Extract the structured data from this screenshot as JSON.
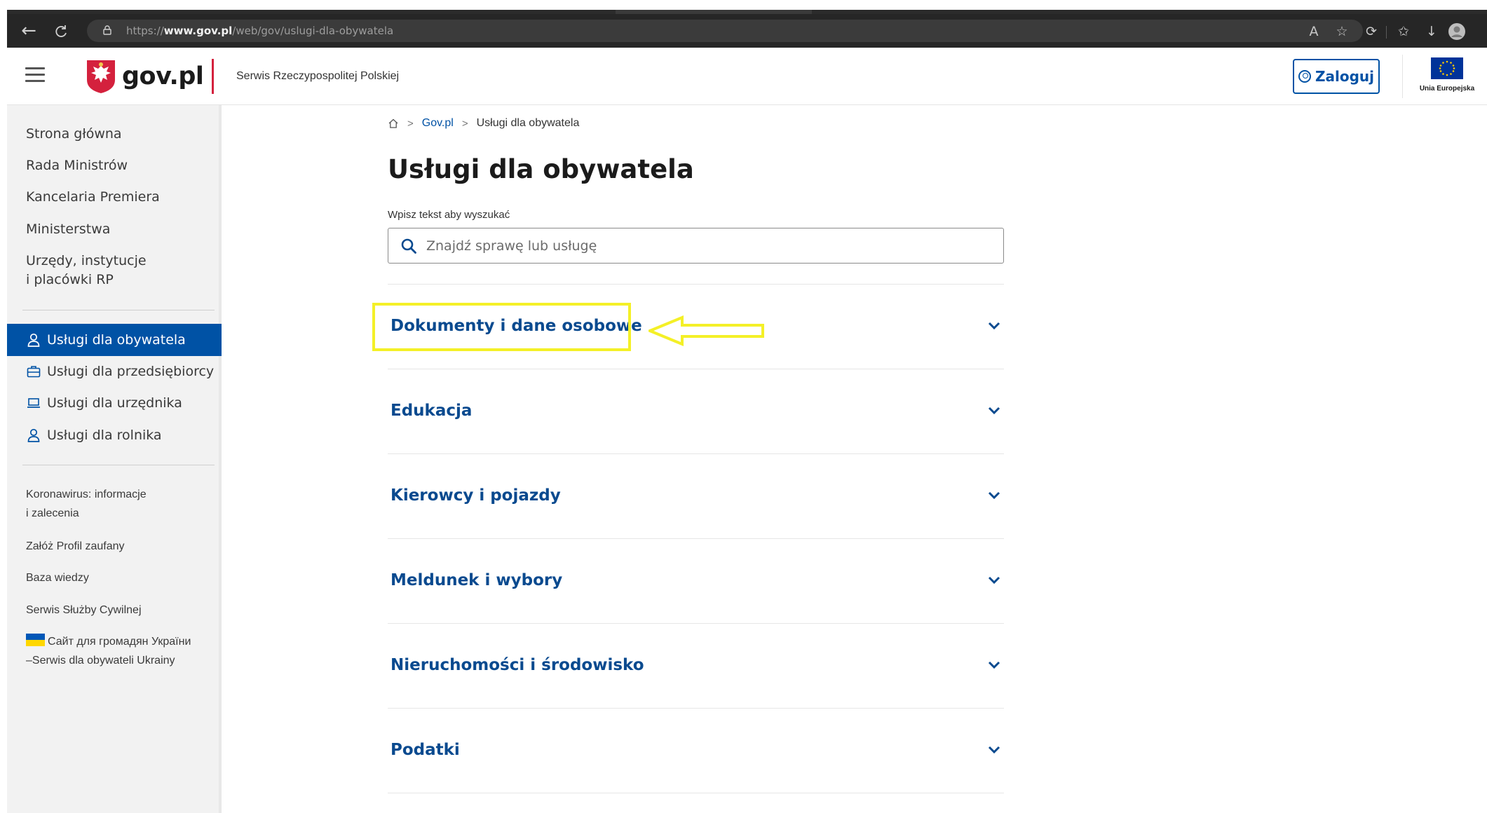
{
  "browser": {
    "url_prefix": "https://",
    "url_domain": "www.gov.pl",
    "url_path": "/web/gov/uslugi-dla-obywatela",
    "icons": [
      "back-icon",
      "refresh-icon",
      "lock-icon",
      "read-aloud-icon",
      "add-favorite-icon",
      "extensions-icon",
      "favorites-icon",
      "downloads-icon",
      "profile-icon"
    ]
  },
  "header": {
    "logo": "gov.pl",
    "service_name": "Serwis Rzeczypospolitej Polskiej",
    "login_label": "Zaloguj",
    "eu_label": "Unia Europejska"
  },
  "sidebar": {
    "main_links": [
      "Strona główna",
      "Rada Ministrów",
      "Kancelaria Premiera",
      "Ministerstwa"
    ],
    "offices_line1": "Urzędy, instytucje",
    "offices_line2": "i placówki RP",
    "services": [
      {
        "label": "Usługi dla obywatela",
        "icon": "user-icon",
        "active": true
      },
      {
        "label": "Usługi dla przedsiębiorcy",
        "icon": "briefcase-icon",
        "active": false
      },
      {
        "label": "Usługi dla urzędnika",
        "icon": "laptop-icon",
        "active": false
      },
      {
        "label": "Usługi dla rolnika",
        "icon": "user-icon",
        "active": false
      }
    ],
    "covid_line1": "Koronawirus: informacje",
    "covid_line2": "i zalecenia",
    "extra_links": [
      "Załóż Profil zaufany",
      "Baza wiedzy",
      "Serwis Służby Cywilnej"
    ],
    "ukraine_line1": "Сайт для громадян України",
    "ukraine_line2": "–Serwis dla obywateli Ukrainy"
  },
  "breadcrumb": {
    "home_icon": "home-icon",
    "items": [
      "Gov.pl",
      "Usługi dla obywatela"
    ]
  },
  "main": {
    "title": "Usługi dla obywatela",
    "search_label": "Wpisz tekst aby wyszukać",
    "search_placeholder": "Znajdź sprawę lub usługę",
    "search_value": "",
    "categories": [
      "Dokumenty i dane osobowe",
      "Edukacja",
      "Kierowcy i pojazdy",
      "Meldunek i wybory",
      "Nieruchomości i środowisko",
      "Podatki"
    ]
  },
  "colors": {
    "brand_blue": "#0052a5",
    "category_text": "#0a4a8f",
    "logo_red": "#d4213d",
    "annotation_yellow": "#f4f027"
  }
}
